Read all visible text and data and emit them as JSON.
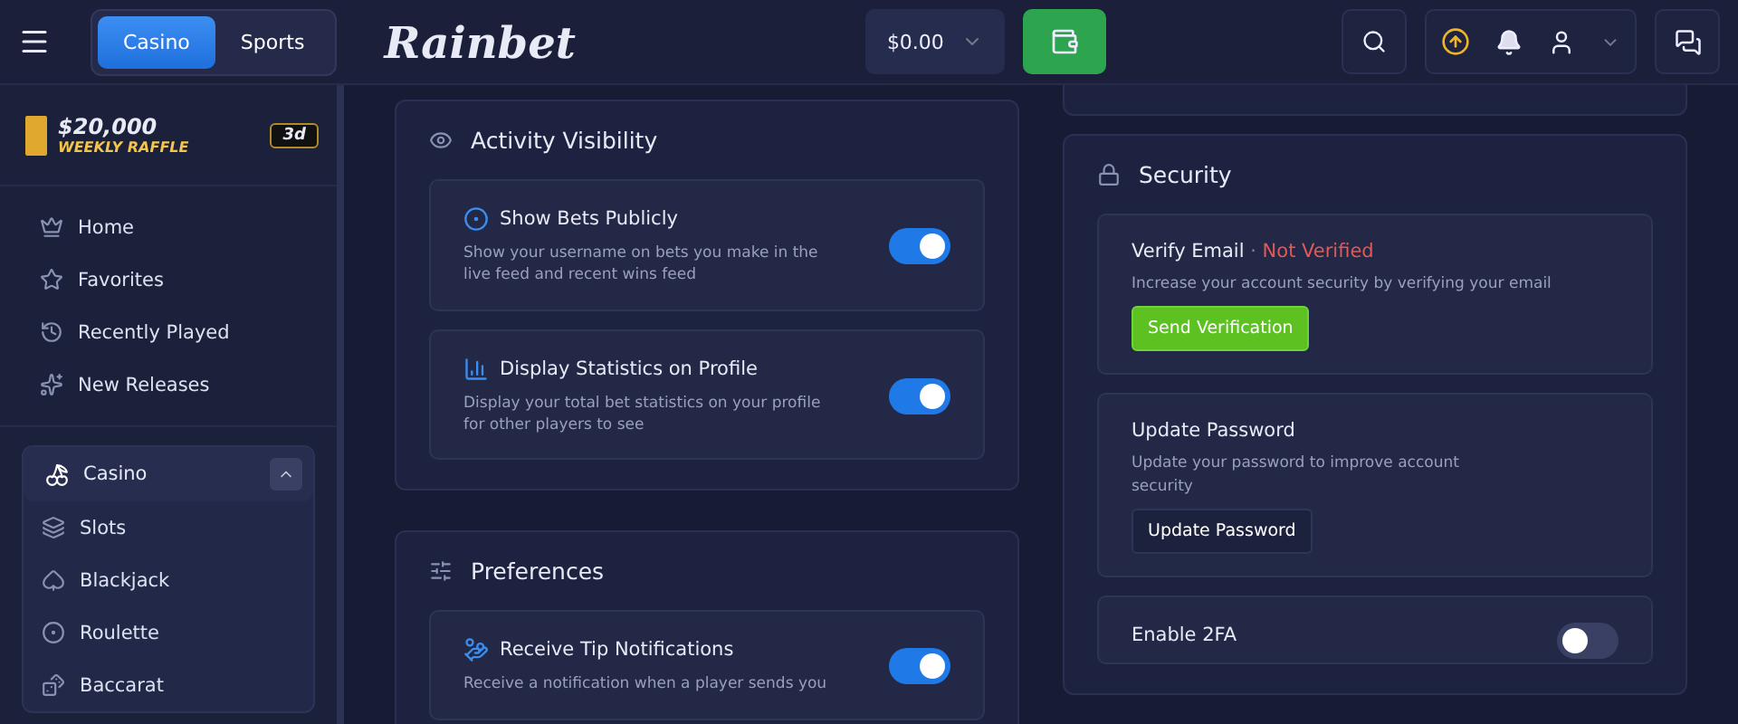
{
  "header": {
    "modes": [
      {
        "label": "Casino",
        "selected": true
      },
      {
        "label": "Sports",
        "selected": false
      }
    ],
    "logo": "Rainbet",
    "balance": "$0.00"
  },
  "sidebar": {
    "raffle": {
      "amount": "$20,000",
      "label": "WEEKLY RAFFLE",
      "badge": "3d"
    },
    "nav": [
      {
        "label": "Home"
      },
      {
        "label": "Favorites"
      },
      {
        "label": "Recently Played"
      },
      {
        "label": "New Releases"
      }
    ],
    "section": {
      "label": "Casino",
      "expanded": true,
      "items": [
        {
          "label": "Slots"
        },
        {
          "label": "Blackjack"
        },
        {
          "label": "Roulette"
        },
        {
          "label": "Baccarat"
        }
      ]
    }
  },
  "left_panels": [
    {
      "title": "Activity Visibility",
      "items": [
        {
          "title": "Show Bets Publicly",
          "description": "Show your username on bets you make in the live feed and recent wins feed",
          "on": true
        },
        {
          "title": "Display Statistics on Profile",
          "description": "Display your total bet statistics on your profile for other players to see",
          "on": true
        }
      ]
    },
    {
      "title": "Preferences",
      "items": [
        {
          "title": "Receive Tip Notifications",
          "description": "Receive a notification when a player sends you",
          "on": true
        }
      ]
    }
  ],
  "security": {
    "title": "Security",
    "items": [
      {
        "kind": "button",
        "title": "Verify Email",
        "separator": "·",
        "status": "Not Verified",
        "description": "Increase your account security by verifying your email",
        "button": "Send Verification",
        "primary": true
      },
      {
        "kind": "button",
        "title": "Update Password",
        "description": "Update your password to improve account security",
        "button": "Update Password",
        "primary": false
      },
      {
        "kind": "toggle",
        "title": "Enable 2FA",
        "on": false
      }
    ]
  }
}
